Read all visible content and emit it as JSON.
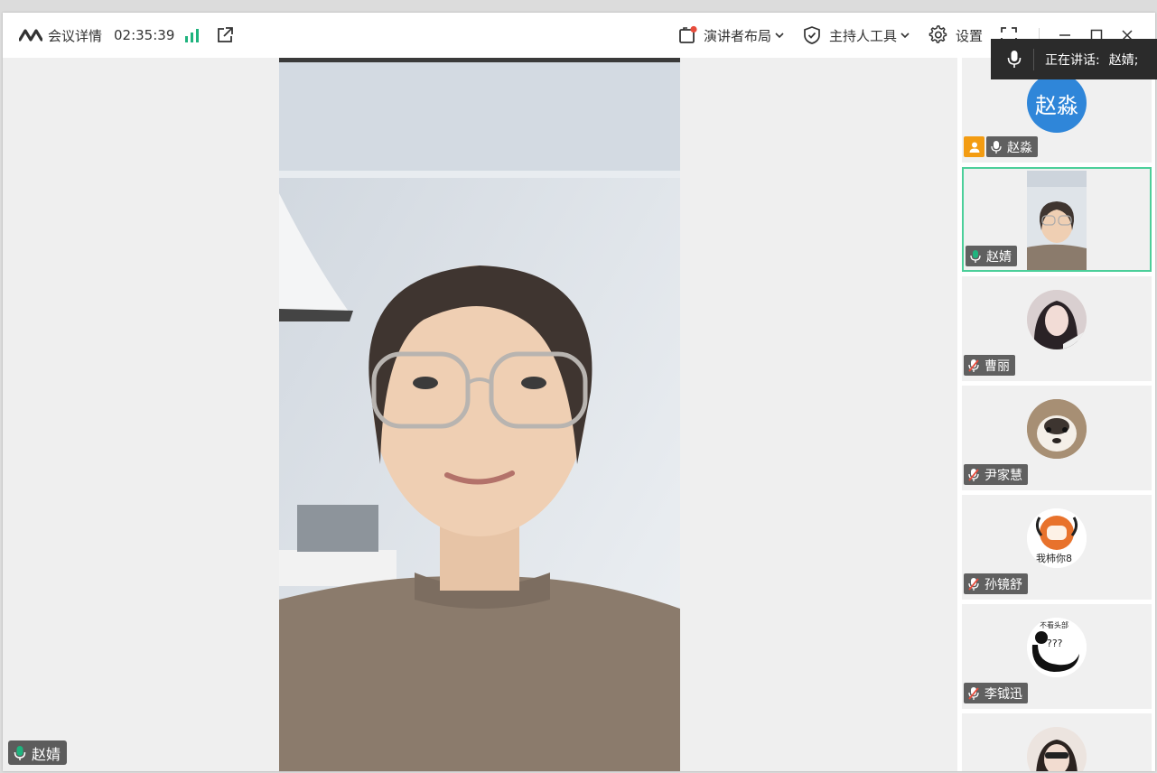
{
  "titlebar": {
    "meeting_details": "会议详情",
    "timer": "02:35:39",
    "presenter_layout": "演讲者布局",
    "host_tools": "主持人工具",
    "settings": "设置"
  },
  "speaking": {
    "label": "正在讲话:",
    "name": "赵婧;"
  },
  "main_video": {
    "name": "赵婧"
  },
  "participants": [
    {
      "name": "赵淼",
      "avatar_text": "赵淼",
      "role": "host",
      "mic": "on"
    },
    {
      "name": "赵婧",
      "mic": "speaking",
      "active": true
    },
    {
      "name": "曹丽",
      "mic": "muted"
    },
    {
      "name": "尹家慧",
      "mic": "muted"
    },
    {
      "name": "孙镜舒",
      "mic": "muted",
      "avatar_text": "我柿你8"
    },
    {
      "name": "李钺迅",
      "mic": "muted",
      "avatar_text": "不看头部",
      "avatar_text2": "???"
    }
  ],
  "colors": {
    "accent_green": "#1fb37e",
    "active_border": "#4ccf9a",
    "host_badge": "#f39c12",
    "avatar_blue": "#2f86d9",
    "muted_red": "#e74c3c"
  }
}
